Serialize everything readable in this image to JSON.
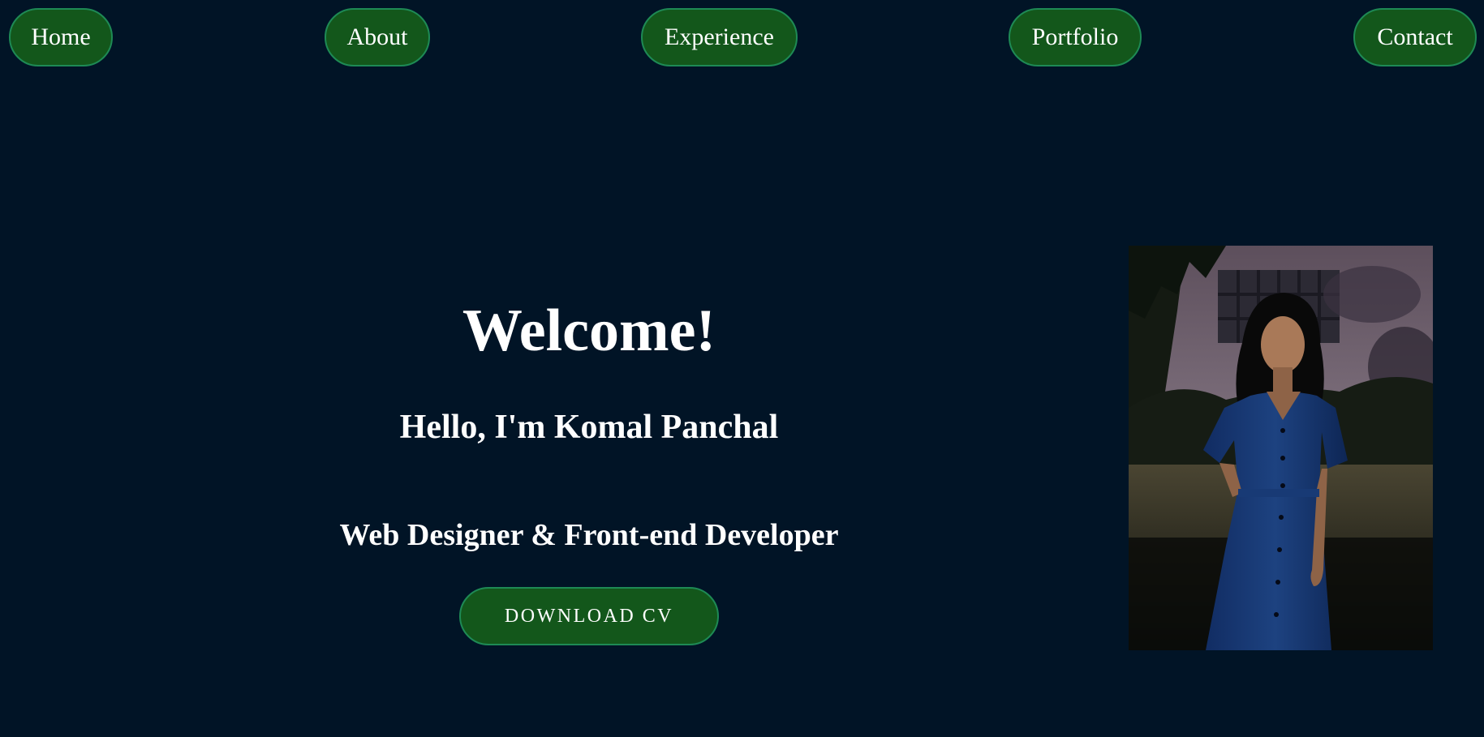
{
  "nav": {
    "items": [
      {
        "label": "Home"
      },
      {
        "label": "About"
      },
      {
        "label": "Experience"
      },
      {
        "label": "Portfolio"
      },
      {
        "label": "Contact"
      }
    ]
  },
  "hero": {
    "welcome": "Welcome!",
    "greeting": "Hello, I'm Komal Panchal",
    "role": "Web Designer & Front-end Developer",
    "cta_label": "DOWNLOAD CV"
  },
  "colors": {
    "background": "#011426",
    "button_fill": "#13571b",
    "button_border": "#1e8a55",
    "text": "#ffffff"
  }
}
